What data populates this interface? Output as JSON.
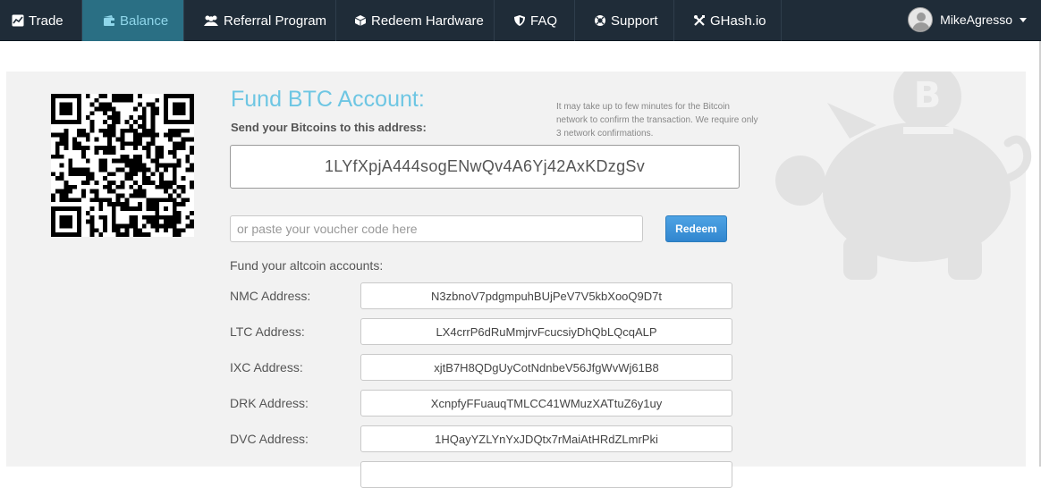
{
  "nav": {
    "items": [
      {
        "label": "Trade",
        "icon": "chart-icon",
        "active": false
      },
      {
        "label": "Balance",
        "icon": "wallet-icon",
        "active": true
      },
      {
        "label": "Referral Program",
        "icon": "users-icon",
        "active": false
      },
      {
        "label": "Redeem Hardware",
        "icon": "cube-icon",
        "active": false
      },
      {
        "label": "FAQ",
        "icon": "shield-icon",
        "active": false
      },
      {
        "label": "Support",
        "icon": "lifebuoy-icon",
        "active": false
      },
      {
        "label": "GHash.io",
        "icon": "tools-icon",
        "active": false
      }
    ],
    "user": {
      "name": "MikeAgresso"
    }
  },
  "fund": {
    "title": "Fund BTC Account:",
    "send_label": "Send your Bitcoins to this address:",
    "notice": "It may take up to few minutes for the Bitcoin network to confirm the transaction. We require only 3 network confirmations.",
    "btc_address": "1LYfXpjA444sogENwQv4A6Yj42AxKDzgSv"
  },
  "voucher": {
    "placeholder": "or paste your voucher code here",
    "redeem_label": "Redeem"
  },
  "altcoins": {
    "heading": "Fund your altcoin accounts:",
    "rows": [
      {
        "label": "NMC Address:",
        "address": "N3zbnoV7pdgmpuhBUjPeV7V5kbXooQ9D7t"
      },
      {
        "label": "LTC Address:",
        "address": "LX4crrP6dRuMmjrvFcucsiyDhQbLQcqALP"
      },
      {
        "label": "IXC Address:",
        "address": "xjtB7H8QDgUyCotNdnbeV56JfgWvWj61B8"
      },
      {
        "label": "DRK Address:",
        "address": "XcnpfyFFuauqTMLCC41WMuzXATtuZ6y1uy"
      },
      {
        "label": "DVC Address:",
        "address": "1HQayYZLYnYxJDQtx7rMaiAtHRdZLmrPki"
      },
      {
        "label": "",
        "address": ""
      }
    ]
  },
  "colors": {
    "navbar": "#1f2c38",
    "active_tab": "#2a6f84",
    "title": "#6ec6e3",
    "button": "#3186cf",
    "panel": "#f2f2f2"
  }
}
